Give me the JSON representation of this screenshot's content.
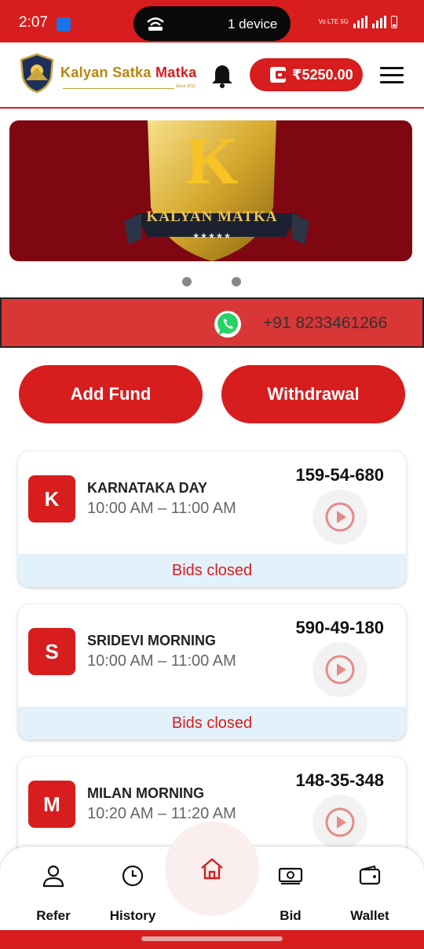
{
  "status_bar": {
    "time": "2:07",
    "pill_text": "1 device",
    "network_text": "Vo LTE 5G"
  },
  "header": {
    "brand_part1": "Kalyan Satka ",
    "brand_part2": "Matka",
    "brand_since": "Since 2012",
    "wallet_amount": "₹5250.00"
  },
  "banner": {
    "caption": "KALYAN MATKA",
    "letter": "K",
    "stars": "★★★★★"
  },
  "carousel": {
    "slide_count": 2
  },
  "contact": {
    "whatsapp_number": "+91 8233461266"
  },
  "actions": {
    "add_fund": "Add Fund",
    "withdrawal": "Withdrawal"
  },
  "games": [
    {
      "letter": "K",
      "name": "KARNATAKA DAY",
      "time": "10:00 AM – 11:00 AM",
      "result": "159-54-680",
      "status": "Bids closed"
    },
    {
      "letter": "S",
      "name": "SRIDEVI MORNING",
      "time": "10:00 AM – 11:00 AM",
      "result": "590-49-180",
      "status": "Bids closed"
    },
    {
      "letter": "M",
      "name": "MILAN MORNING",
      "time": "10:20 AM – 11:20 AM",
      "result": "148-35-348",
      "status": ""
    }
  ],
  "bottom_nav": {
    "refer": "Refer",
    "history": "History",
    "home": "",
    "bid": "Bid",
    "wallet": "Wallet"
  },
  "colors": {
    "primary_red": "#d71d1d",
    "banner_maroon": "#7e0711",
    "gold": "#b8860b",
    "status_bg": "#e3f1fb",
    "whatsapp_green": "#25d366"
  },
  "icons": [
    "wifi-hotspot-icon",
    "logo-shield-icon",
    "bell-icon",
    "wallet-icon",
    "menu-icon",
    "whatsapp-icon",
    "play-icon",
    "user-icon",
    "clock-icon",
    "home-icon",
    "cash-icon",
    "wallet-nav-icon"
  ]
}
